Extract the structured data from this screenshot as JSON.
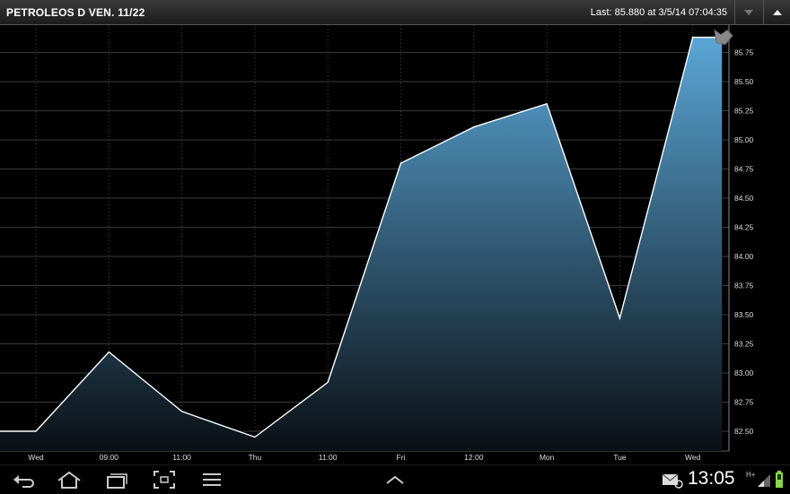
{
  "header": {
    "title": "PETROLEOS D VEN. 11/22",
    "last_label": "Last: 85.880 at 3/5/14 07:04:35"
  },
  "status_bar": {
    "time": "13:05",
    "network": "H+"
  },
  "colors": {
    "line": "#ffffff",
    "fill_top": "#5aa6d6",
    "fill_bottom": "#0a0f14",
    "grid": "#3a3a3a"
  },
  "chart_data": {
    "type": "area",
    "x_tick_labels": [
      "Wed",
      "09:00",
      "11:00",
      "Thu",
      "11:00",
      "Fri",
      "12:00",
      "Mon",
      "Tue",
      "Wed"
    ],
    "y_ticks": [
      82.5,
      82.75,
      83.0,
      83.25,
      83.5,
      83.75,
      84.0,
      84.25,
      84.5,
      84.75,
      85.0,
      85.25,
      85.5,
      85.75
    ],
    "y_tick_labels": [
      "82.50",
      "82.75",
      "83.00",
      "83.25",
      "83.50",
      "83.75",
      "84.00",
      "84.25",
      "84.50",
      "84.75",
      "85.00",
      "85.25",
      "85.50",
      "85.75"
    ],
    "ylim": [
      82.5,
      85.88
    ],
    "series": [
      {
        "points": [
          {
            "t": -0.5,
            "v": 82.5
          },
          {
            "t": 0.0,
            "v": 82.5
          },
          {
            "t": 1.0,
            "v": 83.18
          },
          {
            "t": 2.0,
            "v": 82.67
          },
          {
            "t": 3.0,
            "v": 82.45
          },
          {
            "t": 4.0,
            "v": 82.92
          },
          {
            "t": 5.0,
            "v": 84.8
          },
          {
            "t": 6.0,
            "v": 85.11
          },
          {
            "t": 7.0,
            "v": 85.31
          },
          {
            "t": 8.0,
            "v": 83.47
          },
          {
            "t": 9.0,
            "v": 85.88
          },
          {
            "t": 9.4,
            "v": 85.88
          }
        ]
      }
    ],
    "last_value": 85.88,
    "grid": true
  }
}
